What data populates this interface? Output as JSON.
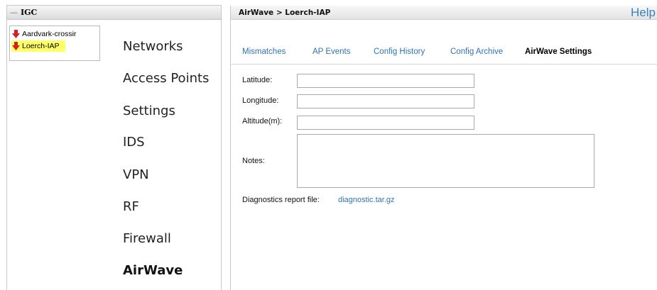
{
  "left_panel": {
    "title": "IGC",
    "devices": [
      {
        "label": "Aardvark-crossir",
        "icon": "down-arrow-icon",
        "selected": false
      },
      {
        "label": "Loerch-IAP",
        "icon": "down-arrow-icon",
        "selected": true
      }
    ],
    "nav": [
      "Networks",
      "Access Points",
      "Settings",
      "IDS",
      "VPN",
      "RF",
      "Firewall",
      "AirWave"
    ],
    "active_nav": "AirWave",
    "highlight_color": "#ffff66",
    "arrow_color": "#d42020"
  },
  "right_panel": {
    "breadcrumb": "AirWave > Loerch-IAP",
    "help": "Help",
    "tabs": [
      "Mismatches",
      "AP Events",
      "Config History",
      "Config Archive",
      "AirWave Settings"
    ],
    "active_tab": "AirWave Settings",
    "link_color": "#2f73b5",
    "form": {
      "latitude_label": "Latitude:",
      "latitude_value": "",
      "longitude_label": "Longitude:",
      "longitude_value": "",
      "altitude_label": "Altitude(m):",
      "altitude_value": "",
      "notes_label": "Notes:",
      "notes_value": "",
      "diagnostics_label": "Diagnostics report file:",
      "diagnostics_link": "diagnostic.tar.gz"
    }
  }
}
